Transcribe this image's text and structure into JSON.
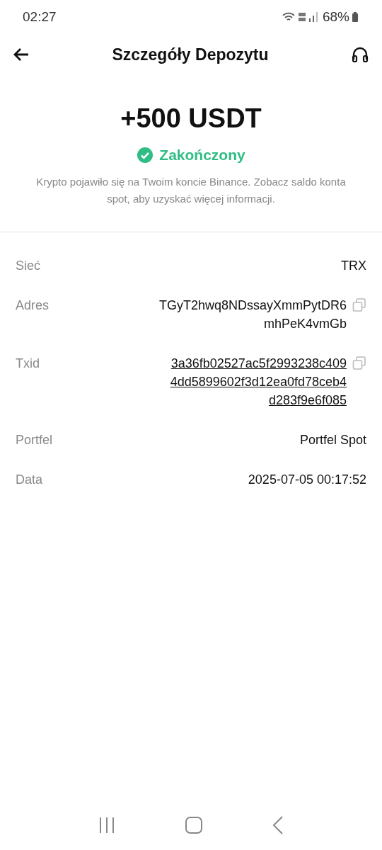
{
  "status_bar": {
    "time": "02:27",
    "battery": "68%"
  },
  "header": {
    "title": "Szczegóły Depozytu"
  },
  "summary": {
    "amount": "+500 USDT",
    "status": "Zakończony",
    "completed": true,
    "note": "Krypto pojawiło się na Twoim koncie Binance. Zobacz saldo konta spot, aby uzyskać więcej informacji."
  },
  "details": [
    {
      "label": "Sieć",
      "lines": [
        "TRX"
      ],
      "link": false,
      "copyable": false
    },
    {
      "label": "Adres",
      "lines": [
        "TGyT2hwq8NDssayXmmPytDR6",
        "mhPeK4vmGb"
      ],
      "link": false,
      "copyable": true
    },
    {
      "label": "Txid",
      "lines": [
        "3a36fb02527ac5f2993238c409",
        "4dd5899602f3d12ea0fd78ceb4",
        "d283f9e6f085"
      ],
      "link": true,
      "copyable": true
    },
    {
      "label": "Portfel",
      "lines": [
        "Portfel Spot"
      ],
      "link": false,
      "copyable": false
    },
    {
      "label": "Data",
      "lines": [
        "2025-07-05 00:17:52"
      ],
      "link": false,
      "copyable": false
    }
  ]
}
